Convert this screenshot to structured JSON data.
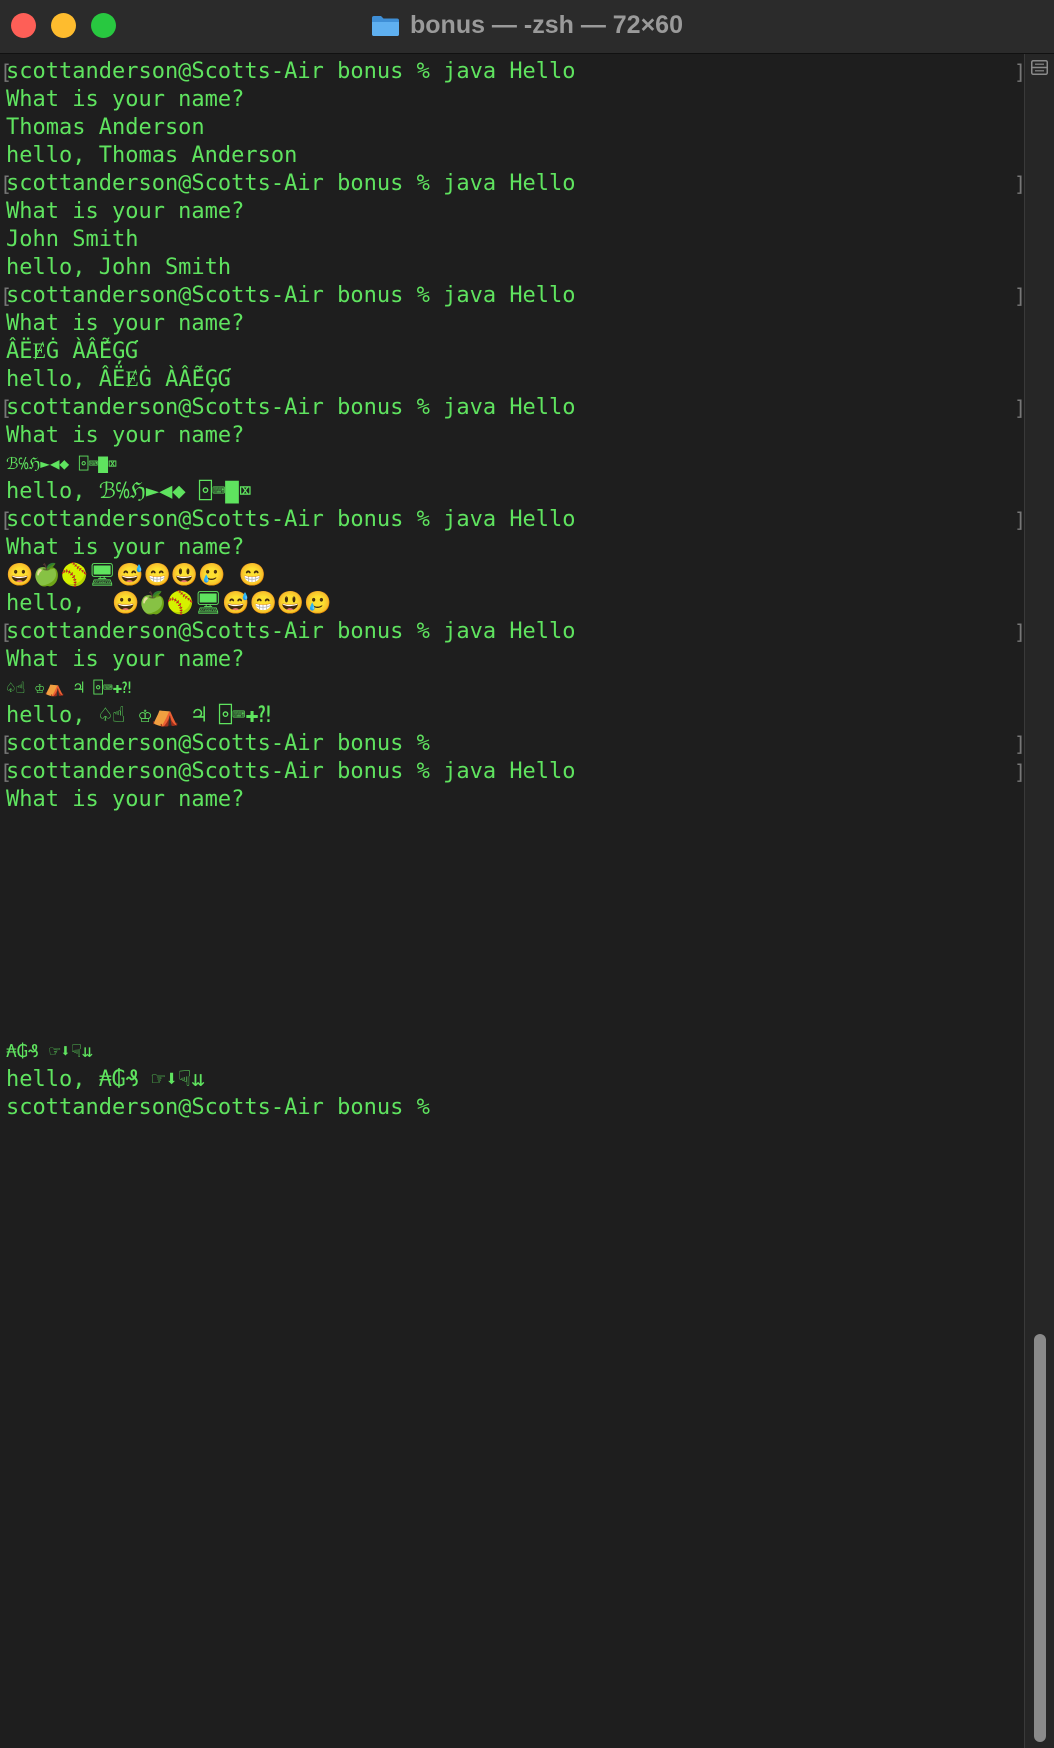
{
  "window": {
    "title": "bonus — -zsh — 72×60"
  },
  "colors": {
    "terminal_text": "#5fe35f",
    "background": "#1e1e1e",
    "close": "#fe5f57",
    "minimize": "#febc2e",
    "maximize": "#28c840"
  },
  "icons": {
    "folder": "folder-icon",
    "split": "split-pane-icon"
  },
  "terminal": {
    "lines": [
      "scottanderson@Scotts-Air bonus % java Hello",
      "What is your name?",
      "Thomas Anderson",
      "hello, Thomas Anderson",
      "scottanderson@Scotts-Air bonus % java Hello",
      "What is your name?",
      "John Smith",
      "hello, John Smith",
      "scottanderson@Scotts-Air bonus % java Hello",
      "What is your name?",
      "ÂËɆĠ ÀẤẼĢƓ",
      "hello, ÂËɆĠ ÀẤẼĢƓ",
      "scottanderson@Scotts-Air bonus % java Hello",
      "What is your name?",
      "ℬ℅ℌ►◀◆ ⌻⌨▇⌧",
      "hello, ℬ℅ℌ►◀◆ ⌻⌨▇⌧",
      "scottanderson@Scotts-Air bonus % java Hello",
      "What is your name?",
      "😀🍏🥎🖥😅😁😃🥲 😁",
      "hello,  😀🍏🥎🖥😅😁😃🥲",
      "scottanderson@Scotts-Air bonus % java Hello",
      "What is your name?",
      "♤☝ ♔⛺ ♃ ⌻⌨✚⁈",
      "hello, ♤☝ ♔⛺ ♃ ⌻⌨✚⁈",
      "scottanderson@Scotts-Air bonus %",
      "scottanderson@Scotts-Air bonus % java Hello",
      "What is your name?",
      "₳₲₰ ☞⬇☟⇊",
      "hello, ₳₲₰ ☞⬇☟⇊",
      "scottanderson@Scotts-Air bonus %"
    ]
  }
}
